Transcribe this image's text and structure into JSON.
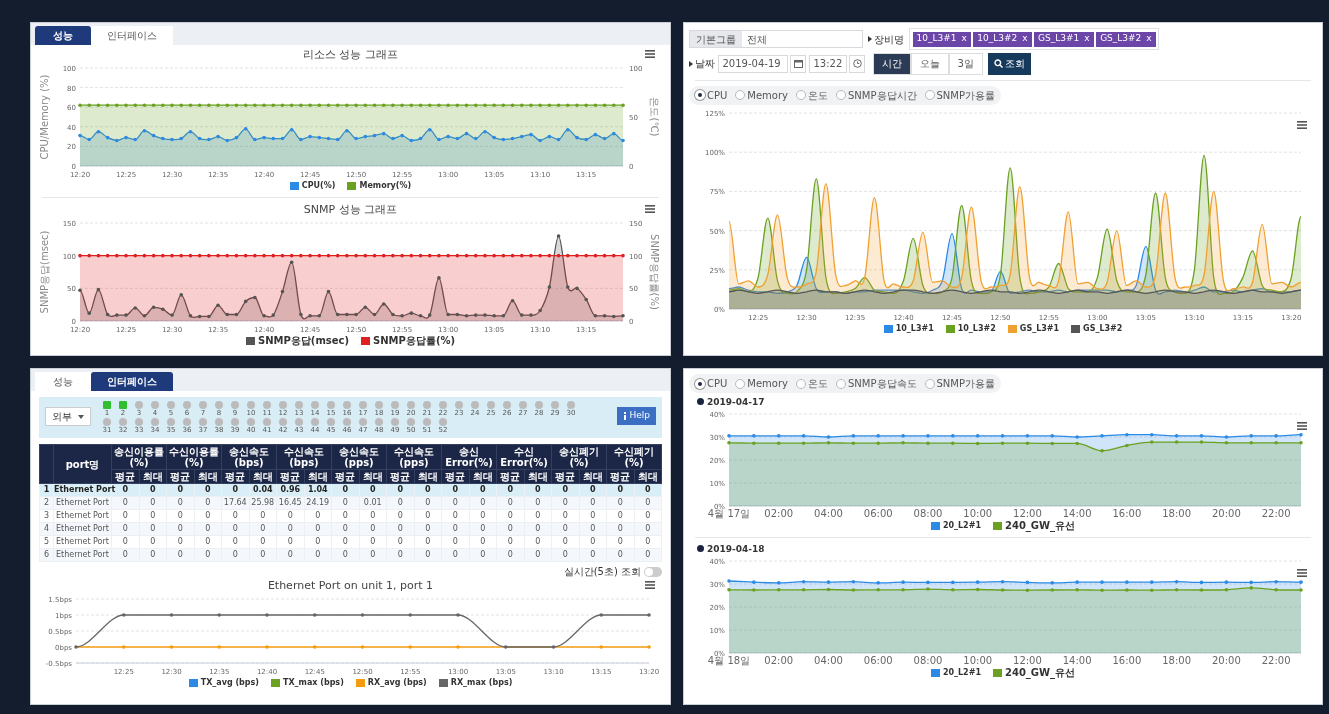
{
  "left_top": {
    "tabs": [
      {
        "label": "성능",
        "selected": true
      },
      {
        "label": "인터페이스",
        "selected": false
      }
    ],
    "resource_chart": {
      "chart_data": {
        "type": "area",
        "title": "리소스 성능 그래프",
        "ylabel": "CPU/Memory (%)",
        "y2label": "온도(℃)",
        "grid": true,
        "categories": [
          "12:20",
          null,
          null,
          null,
          null,
          "12:25",
          null,
          null,
          null,
          null,
          "12:30",
          null,
          null,
          null,
          null,
          "12:35",
          null,
          null,
          null,
          null,
          "12:40",
          null,
          null,
          null,
          null,
          "12:45",
          null,
          null,
          null,
          null,
          "12:50",
          null,
          null,
          null,
          null,
          "12:55",
          null,
          null,
          null,
          null,
          "13:00",
          null,
          null,
          null,
          null,
          "13:05",
          null,
          null,
          null,
          null,
          "13:10",
          null,
          null,
          null,
          null,
          "13:15",
          null,
          null,
          null,
          null
        ],
        "ylim": [
          0,
          100
        ],
        "y2lim": [
          0,
          100
        ],
        "yticks": [
          0,
          20,
          40,
          60,
          80,
          100
        ],
        "y2ticks": [
          0,
          50,
          100
        ],
        "series": [
          {
            "name": "CPU(%)",
            "color": "#2b8ae6",
            "values": [
              31,
              27,
              35,
              29,
              26,
              29,
              27,
              36,
              31,
              28,
              27,
              28,
              35,
              28,
              27,
              30,
              26,
              29,
              38,
              27,
              29,
              28,
              28,
              37,
              27,
              30,
              29,
              28,
              27,
              36,
              28,
              30,
              31,
              33,
              28,
              31,
              26,
              28,
              37,
              27,
              30,
              28,
              33,
              28,
              35,
              29,
              27,
              28,
              30,
              32,
              26,
              30,
              27,
              37,
              29,
              27,
              32,
              28,
              33,
              26
            ]
          },
          {
            "name": "Memory(%)",
            "color": "#6aa121",
            "values": [
              62,
              62,
              62,
              62,
              62,
              62,
              62,
              62,
              62,
              62,
              62,
              62,
              62,
              62,
              62,
              62,
              62,
              62,
              62,
              62,
              62,
              62,
              62,
              62,
              62,
              62,
              62,
              62,
              62,
              62,
              62,
              62,
              62,
              62,
              62,
              62,
              62,
              62,
              62,
              62,
              62,
              62,
              62,
              62,
              62,
              62,
              62,
              62,
              62,
              62,
              62,
              62,
              62,
              62,
              62,
              62,
              62,
              62,
              62,
              62
            ]
          }
        ]
      }
    },
    "snmp_chart": {
      "chart_data": {
        "type": "area",
        "title": "SNMP 성능 그래프",
        "ylabel": "SNMP응답(msec)",
        "y2label": "SNMP응답률(%)",
        "grid": true,
        "categories": [
          "12:20",
          null,
          null,
          null,
          null,
          "12:25",
          null,
          null,
          null,
          null,
          "12:30",
          null,
          null,
          null,
          null,
          "12:35",
          null,
          null,
          null,
          null,
          "12:40",
          null,
          null,
          null,
          null,
          "12:45",
          null,
          null,
          null,
          null,
          "12:50",
          null,
          null,
          null,
          null,
          "12:55",
          null,
          null,
          null,
          null,
          "13:00",
          null,
          null,
          null,
          null,
          "13:05",
          null,
          null,
          null,
          null,
          "13:10",
          null,
          null,
          null,
          null,
          "13:15",
          null,
          null,
          null,
          null
        ],
        "ylim": [
          0,
          150
        ],
        "y2lim": [
          0,
          150
        ],
        "yticks": [
          0,
          50,
          100,
          150
        ],
        "y2ticks": [
          0,
          50,
          100,
          150
        ],
        "series": [
          {
            "name": "SNMP응답(msec)",
            "color": "#555555",
            "values": [
              47,
              12,
              48,
              10,
              9,
              9,
              20,
              8,
              21,
              18,
              9,
              40,
              8,
              7,
              7,
              24,
              10,
              10,
              30,
              36,
              8,
              9,
              45,
              90,
              10,
              8,
              8,
              45,
              10,
              10,
              10,
              21,
              10,
              26,
              10,
              8,
              12,
              8,
              9,
              66,
              10,
              10,
              8,
              9,
              9,
              8,
              8,
              31,
              9,
              9,
              16,
              52,
              130,
              52,
              50,
              33,
              8,
              8,
              7,
              8
            ]
          },
          {
            "name": "SNMP응답률(%)",
            "color": "#e02020",
            "values": [
              100,
              100,
              100,
              100,
              100,
              100,
              100,
              100,
              100,
              100,
              100,
              100,
              100,
              100,
              100,
              100,
              100,
              100,
              100,
              100,
              100,
              100,
              100,
              100,
              100,
              100,
              100,
              100,
              100,
              100,
              100,
              100,
              100,
              100,
              100,
              100,
              100,
              100,
              100,
              100,
              100,
              100,
              100,
              100,
              100,
              100,
              100,
              100,
              100,
              100,
              100,
              100,
              100,
              100,
              100,
              100,
              100,
              100,
              100,
              100
            ]
          }
        ]
      }
    }
  },
  "right_top": {
    "group_label": "기본그룹",
    "group_value": "전체",
    "device_label": "장비명",
    "device_tags": [
      {
        "label": "10_L3#1",
        "remove": "x"
      },
      {
        "label": "10_L3#2",
        "remove": "x"
      },
      {
        "label": "GS_L3#1",
        "remove": "x"
      },
      {
        "label": "GS_L3#2",
        "remove": "x"
      }
    ],
    "date_label": "날짜",
    "date_value": "2019-04-19",
    "time_value": "13:22",
    "periods": [
      {
        "label": "시간",
        "selected": true
      },
      {
        "label": "오늘",
        "selected": false
      },
      {
        "label": "3일",
        "selected": false
      }
    ],
    "search_button": "조회",
    "metrics": [
      {
        "label": "CPU",
        "selected": true
      },
      {
        "label": "Memory",
        "selected": false
      },
      {
        "label": "온도",
        "selected": false
      },
      {
        "label": "SNMP응답시간",
        "selected": false
      },
      {
        "label": "SNMP가용률",
        "selected": false
      }
    ],
    "cpu_chart": {
      "chart_data": {
        "type": "area",
        "grid": true,
        "categories": [
          null,
          null,
          null,
          "12:25",
          null,
          null,
          null,
          null,
          "12:30",
          null,
          null,
          null,
          null,
          "12:35",
          null,
          null,
          null,
          null,
          "12:40",
          null,
          null,
          null,
          null,
          "12:45",
          null,
          null,
          null,
          null,
          "12:50",
          null,
          null,
          null,
          null,
          "12:55",
          null,
          null,
          null,
          null,
          "13:00",
          null,
          null,
          null,
          null,
          "13:05",
          null,
          null,
          null,
          null,
          "13:10",
          null,
          null,
          null,
          null,
          "13:15",
          null,
          null,
          null,
          null,
          "13:20",
          null
        ],
        "ylim": [
          0,
          125
        ],
        "yticks": [
          {
            "value": 0,
            "label": "0%"
          },
          {
            "value": 25,
            "label": "25%"
          },
          {
            "value": 50,
            "label": "50%"
          },
          {
            "value": 75,
            "label": "75%"
          },
          {
            "value": 100,
            "label": "100%"
          },
          {
            "value": 125,
            "label": "125%"
          }
        ],
        "series": [
          {
            "name": "10_L3#1",
            "color": "#2b8ae6",
            "values": [
              13,
              14,
              12,
              11,
              11,
              10,
              11,
              15,
              33,
              13,
              11,
              11,
              10,
              11,
              11,
              12,
              12,
              12,
              12,
              11,
              10,
              12,
              18,
              48,
              13,
              12,
              11,
              11,
              24,
              10,
              11,
              12,
              11,
              11,
              12,
              11,
              12,
              12,
              12,
              12,
              11,
              12,
              15,
              40,
              12,
              11,
              12,
              11,
              12,
              14,
              11,
              11,
              12,
              11,
              12,
              13,
              11,
              11,
              11,
              12
            ]
          },
          {
            "name": "10_L3#2",
            "color": "#6aa121",
            "values": [
              12,
              13,
              11,
              20,
              58,
              18,
              10,
              11,
              25,
              83,
              20,
              10,
              11,
              13,
              20,
              12,
              11,
              10,
              18,
              45,
              15,
              10,
              11,
              20,
              66,
              18,
              10,
              11,
              22,
              90,
              20,
              10,
              11,
              14,
              29,
              13,
              11,
              11,
              20,
              51,
              18,
              11,
              11,
              22,
              74,
              20,
              11,
              10,
              25,
              98,
              20,
              10,
              11,
              20,
              37,
              15,
              12,
              11,
              20,
              59
            ]
          },
          {
            "name": "GS_L3#1",
            "color": "#f0a030",
            "values": [
              56,
              16,
              18,
              14,
              22,
              60,
              20,
              14,
              16,
              24,
              80,
              22,
              15,
              18,
              20,
              71,
              18,
              16,
              14,
              18,
              49,
              17,
              18,
              14,
              20,
              65,
              18,
              14,
              15,
              22,
              78,
              20,
              17,
              15,
              18,
              62,
              16,
              17,
              13,
              17,
              50,
              15,
              18,
              14,
              22,
              74,
              20,
              14,
              15,
              22,
              75,
              18,
              13,
              14,
              17,
              54,
              16,
              17,
              14,
              17
            ]
          },
          {
            "name": "GS_L3#2",
            "color": "#555555",
            "values": [
              11,
              12,
              11,
              10,
              11,
              12,
              11,
              10,
              11,
              12,
              11,
              11,
              10,
              11,
              12,
              11,
              10,
              11,
              12,
              12,
              11,
              10,
              11,
              12,
              11,
              10,
              11,
              12,
              11,
              11,
              10,
              11,
              12,
              11,
              10,
              11,
              12,
              11,
              11,
              10,
              11,
              12,
              11,
              10,
              11,
              12,
              11,
              11,
              10,
              11,
              12,
              11,
              10,
              11,
              12,
              11,
              11,
              10,
              11,
              12
            ]
          }
        ]
      }
    }
  },
  "left_bottom": {
    "tabs": [
      {
        "label": "성능",
        "selected": false
      },
      {
        "label": "인터페이스",
        "selected": true
      }
    ],
    "scope_select": "외부",
    "ports": [
      {
        "label": "1",
        "up": true
      },
      {
        "label": "2",
        "up": true
      },
      {
        "label": "3",
        "up": false
      },
      {
        "label": "4",
        "up": false
      },
      {
        "label": "5",
        "up": false
      },
      {
        "label": "6",
        "up": false
      },
      {
        "label": "7",
        "up": false
      },
      {
        "label": "8",
        "up": false
      },
      {
        "label": "9",
        "up": false
      },
      {
        "label": "10",
        "up": false
      },
      {
        "label": "11",
        "up": false
      },
      {
        "label": "12",
        "up": false
      },
      {
        "label": "13",
        "up": false
      },
      {
        "label": "14",
        "up": false
      },
      {
        "label": "15",
        "up": false
      },
      {
        "label": "16",
        "up": false
      },
      {
        "label": "17",
        "up": false
      },
      {
        "label": "18",
        "up": false
      },
      {
        "label": "19",
        "up": false
      },
      {
        "label": "20",
        "up": false
      },
      {
        "label": "21",
        "up": false
      },
      {
        "label": "22",
        "up": false
      },
      {
        "label": "23",
        "up": false
      },
      {
        "label": "24",
        "up": false
      },
      {
        "label": "25",
        "up": false
      },
      {
        "label": "26",
        "up": false
      },
      {
        "label": "27",
        "up": false
      },
      {
        "label": "28",
        "up": false
      },
      {
        "label": "29",
        "up": false
      },
      {
        "label": "30",
        "up": false
      },
      {
        "label": "31",
        "up": false
      },
      {
        "label": "32",
        "up": false
      },
      {
        "label": "33",
        "up": false
      },
      {
        "label": "34",
        "up": false
      },
      {
        "label": "35",
        "up": false
      },
      {
        "label": "36",
        "up": false
      },
      {
        "label": "37",
        "up": false
      },
      {
        "label": "38",
        "up": false
      },
      {
        "label": "39",
        "up": false
      },
      {
        "label": "40",
        "up": false
      },
      {
        "label": "41",
        "up": false
      },
      {
        "label": "42",
        "up": false
      },
      {
        "label": "43",
        "up": false
      },
      {
        "label": "44",
        "up": false
      },
      {
        "label": "45",
        "up": false
      },
      {
        "label": "46",
        "up": false
      },
      {
        "label": "47",
        "up": false
      },
      {
        "label": "48",
        "up": false
      },
      {
        "label": "49",
        "up": false
      },
      {
        "label": "50",
        "up": false
      },
      {
        "label": "51",
        "up": false
      },
      {
        "label": "52",
        "up": false
      }
    ],
    "help_button": "Help",
    "table": {
      "port_header": "port명",
      "groups": [
        {
          "label": "송신이용률(%)",
          "sub": [
            "평균",
            "최대"
          ]
        },
        {
          "label": "수신이용률(%)",
          "sub": [
            "평균",
            "최대"
          ]
        },
        {
          "label": "송신속도(bps)",
          "sub": [
            "평균",
            "최대"
          ]
        },
        {
          "label": "수신속도(bps)",
          "sub": [
            "평균",
            "최대"
          ]
        },
        {
          "label": "송신속도(pps)",
          "sub": [
            "평균",
            "최대"
          ]
        },
        {
          "label": "수신속도(pps)",
          "sub": [
            "평균",
            "최대"
          ]
        },
        {
          "label": "송신Error(%)",
          "sub": [
            "평균",
            "최대"
          ]
        },
        {
          "label": "수신Error(%)",
          "sub": [
            "평균",
            "최대"
          ]
        },
        {
          "label": "송신폐기(%)",
          "sub": [
            "평균",
            "최대"
          ]
        },
        {
          "label": "수신폐기(%)",
          "sub": [
            "평균",
            "최대"
          ]
        }
      ],
      "rows": [
        {
          "num": "1",
          "name": "Ethernet Port",
          "selected": true,
          "values": [
            "0",
            "0",
            "0",
            "0",
            "0",
            "0.04",
            "0.96",
            "1.04",
            "0",
            "0",
            "0",
            "0",
            "0",
            "0",
            "0",
            "0",
            "0",
            "0",
            "0",
            "0"
          ]
        },
        {
          "num": "2",
          "name": "Ethernet Port",
          "selected": false,
          "values": [
            "0",
            "0",
            "0",
            "0",
            "17.64",
            "25.98",
            "16.45",
            "24.19",
            "0",
            "0.01",
            "0",
            "0",
            "0",
            "0",
            "0",
            "0",
            "0",
            "0",
            "0",
            "0"
          ]
        },
        {
          "num": "3",
          "name": "Ethernet Port",
          "selected": false,
          "values": [
            "0",
            "0",
            "0",
            "0",
            "0",
            "0",
            "0",
            "0",
            "0",
            "0",
            "0",
            "0",
            "0",
            "0",
            "0",
            "0",
            "0",
            "0",
            "0",
            "0"
          ]
        },
        {
          "num": "4",
          "name": "Ethernet Port",
          "selected": false,
          "values": [
            "0",
            "0",
            "0",
            "0",
            "0",
            "0",
            "0",
            "0",
            "0",
            "0",
            "0",
            "0",
            "0",
            "0",
            "0",
            "0",
            "0",
            "0",
            "0",
            "0"
          ]
        },
        {
          "num": "5",
          "name": "Ethernet Port",
          "selected": false,
          "values": [
            "0",
            "0",
            "0",
            "0",
            "0",
            "0",
            "0",
            "0",
            "0",
            "0",
            "0",
            "0",
            "0",
            "0",
            "0",
            "0",
            "0",
            "0",
            "0",
            "0"
          ]
        },
        {
          "num": "6",
          "name": "Ethernet Port",
          "selected": false,
          "values": [
            "0",
            "0",
            "0",
            "0",
            "0",
            "0",
            "0",
            "0",
            "0",
            "0",
            "0",
            "0",
            "0",
            "0",
            "0",
            "0",
            "0",
            "0",
            "0",
            "0"
          ]
        }
      ]
    },
    "realtime_toggle": {
      "label": "실시간(5초) 조회",
      "on": false
    },
    "port_chart": {
      "chart_data": {
        "type": "line",
        "title": "Ethernet Port on unit 1, port 1",
        "grid": true,
        "categories": [
          null,
          "12:25",
          "12:30",
          "12:35",
          "12:40",
          "12:45",
          "12:50",
          "12:55",
          "13:00",
          "13:05",
          "13:10",
          "13:15",
          "13:20"
        ],
        "ylim": [
          -0.5,
          1.5
        ],
        "yticks": [
          {
            "value": -0.5,
            "label": "-0.5bps"
          },
          {
            "value": 0,
            "label": "0bps"
          },
          {
            "value": 0.5,
            "label": "0.5bps"
          },
          {
            "value": 1,
            "label": "1bps"
          },
          {
            "value": 1.5,
            "label": "1.5bps"
          }
        ],
        "series": [
          {
            "name": "TX_avg (bps)",
            "color": "#2b8ae6",
            "values": [
              null,
              null,
              null,
              null,
              null,
              null,
              null,
              null,
              null,
              null,
              null,
              null,
              null
            ]
          },
          {
            "name": "TX_max (bps)",
            "color": "#6aa121",
            "values": [
              null,
              null,
              null,
              null,
              null,
              null,
              null,
              null,
              null,
              null,
              null,
              null,
              null
            ]
          },
          {
            "name": "RX_avg (bps)",
            "color": "#f39c12",
            "values": [
              0,
              0,
              0,
              0,
              0,
              0,
              0,
              0,
              0,
              0,
              0,
              0,
              0
            ]
          },
          {
            "name": "RX_max (bps)",
            "color": "#666666",
            "values": [
              0,
              1,
              1,
              1,
              1,
              1,
              1,
              1,
              1,
              0,
              0,
              1,
              1
            ]
          }
        ]
      }
    }
  },
  "right_bottom": {
    "metrics": [
      {
        "label": "CPU",
        "selected": true
      },
      {
        "label": "Memory",
        "selected": false
      },
      {
        "label": "온도",
        "selected": false
      },
      {
        "label": "SNMP응답속도",
        "selected": false
      },
      {
        "label": "SNMP가용률",
        "selected": false
      }
    ],
    "daily_charts": [
      {
        "date": "2019-04-17",
        "chart_data": {
          "type": "area",
          "grid": true,
          "categories": [
            "4월 17일",
            null,
            "02:00",
            null,
            "04:00",
            null,
            "06:00",
            null,
            "08:00",
            null,
            "10:00",
            null,
            "12:00",
            null,
            "14:00",
            null,
            "16:00",
            null,
            "18:00",
            null,
            "20:00",
            null,
            "22:00",
            null
          ],
          "ylim": [
            0,
            40
          ],
          "yticks": [
            {
              "value": 0,
              "label": "0%"
            },
            {
              "value": 10,
              "label": "10%"
            },
            {
              "value": 20,
              "label": "20%"
            },
            {
              "value": 30,
              "label": "30%"
            },
            {
              "value": 40,
              "label": "40%"
            }
          ],
          "series": [
            {
              "name": "20_L2#1",
              "color": "#2b8ae6",
              "values": [
                30.5,
                30.5,
                30.5,
                30.5,
                30,
                30.5,
                30.5,
                30.5,
                30.5,
                30.5,
                30.5,
                30.5,
                30.5,
                30.5,
                30,
                30.5,
                31,
                31,
                30.5,
                30.5,
                30,
                30.5,
                30.5,
                31
              ]
            },
            {
              "name": "240_GW_유선",
              "color": "#6aa121",
              "values": [
                27.5,
                27.3,
                27.3,
                27.3,
                27.5,
                27.3,
                27.3,
                27.5,
                27.3,
                27.3,
                27.2,
                27.3,
                27.3,
                27.2,
                27.2,
                24,
                26.3,
                27.8,
                27.8,
                27.8,
                27.5,
                27.5,
                27.5,
                27.5
              ]
            }
          ]
        }
      },
      {
        "date": "2019-04-18",
        "chart_data": {
          "type": "area",
          "grid": true,
          "categories": [
            "4월 18일",
            null,
            "02:00",
            null,
            "04:00",
            null,
            "06:00",
            null,
            "08:00",
            null,
            "10:00",
            null,
            "12:00",
            null,
            "14:00",
            null,
            "16:00",
            null,
            "18:00",
            null,
            "20:00",
            null,
            "22:00",
            null
          ],
          "ylim": [
            0,
            40
          ],
          "yticks": [
            {
              "value": 0,
              "label": "0%"
            },
            {
              "value": 10,
              "label": "10%"
            },
            {
              "value": 20,
              "label": "20%"
            },
            {
              "value": 30,
              "label": "30%"
            },
            {
              "value": 40,
              "label": "40%"
            }
          ],
          "series": [
            {
              "name": "20_L2#1",
              "color": "#2b8ae6",
              "values": [
                31.3,
                30.8,
                30.5,
                31,
                30.8,
                31,
                30.5,
                30.8,
                30.7,
                30.7,
                30.8,
                31,
                30.7,
                30.5,
                30.8,
                30.8,
                30.8,
                30.8,
                31,
                30.7,
                30.8,
                30.7,
                31,
                30.8
              ]
            },
            {
              "name": "240_GW_유선",
              "color": "#6aa121",
              "values": [
                27.5,
                27.4,
                27.5,
                27.5,
                27.6,
                27.4,
                27.5,
                27.5,
                27.8,
                27.5,
                27.6,
                27.4,
                27.3,
                27.4,
                27.5,
                27.3,
                27.4,
                27.3,
                27.5,
                27.4,
                27.5,
                28.3,
                27.5,
                27.4
              ]
            }
          ]
        }
      }
    ]
  }
}
